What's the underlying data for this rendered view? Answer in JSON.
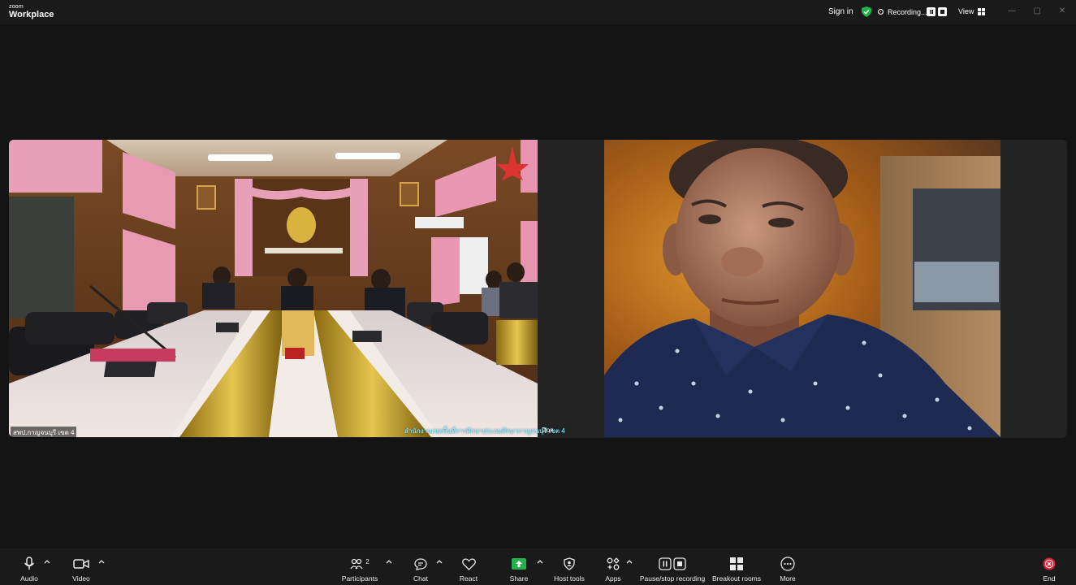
{
  "app": {
    "brand_top": "zoom",
    "brand_bottom": "Workplace"
  },
  "titlebar": {
    "sign_in": "Sign in",
    "recording": "Recording...",
    "view": "View"
  },
  "participants": {
    "tile1_name": "สพป.กาญจนบุรี เขต 4",
    "tile1_caption": "สำนักงานเขตพื้นที่การศึกษาประถมศึกษากาญจนบุรี เขต 4",
    "tile2_name": "Don"
  },
  "toolbar": {
    "audio": "Audio",
    "video": "Video",
    "participants": "Participants",
    "participants_count": "2",
    "chat": "Chat",
    "react": "React",
    "share": "Share",
    "host_tools": "Host tools",
    "apps": "Apps",
    "recording": "Pause/stop recording",
    "breakout": "Breakout rooms",
    "more": "More",
    "end": "End"
  },
  "colors": {
    "share_green": "#22b14c",
    "end_red": "#e0213a",
    "shield_green": "#1fb34a"
  }
}
